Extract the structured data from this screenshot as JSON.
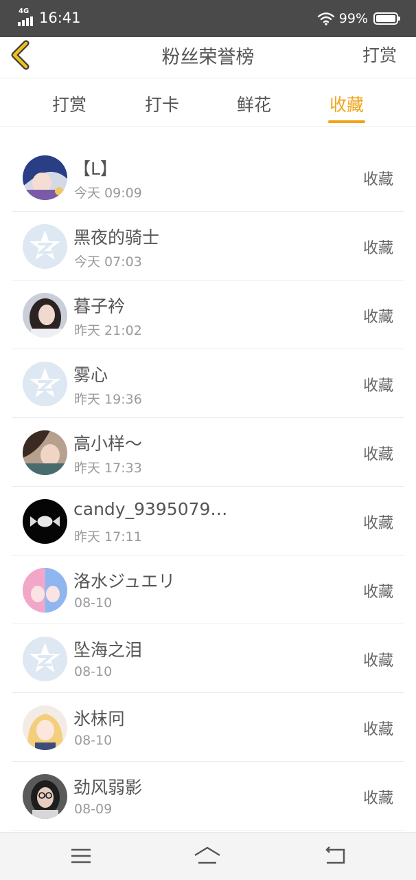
{
  "status_bar": {
    "network": "4G",
    "time": "16:41",
    "battery": "99%",
    "battery_level": 0.99
  },
  "nav": {
    "title": "粉丝荣誉榜",
    "action": "打赏",
    "back_icon": "chevron-left-icon"
  },
  "tabs": [
    {
      "label": "打赏",
      "active": false
    },
    {
      "label": "打卡",
      "active": false
    },
    {
      "label": "鲜花",
      "active": false
    },
    {
      "label": "收藏",
      "active": true
    }
  ],
  "colors": {
    "accent": "#f0a418",
    "status_bar": "#4a4a4a",
    "default_avatar": "#dde8f3"
  },
  "fans": [
    {
      "name": "【L】",
      "time": "今天 09:09",
      "action": "收藏",
      "avatar": "anime-blue-hair"
    },
    {
      "name": "黑夜的骑士",
      "time": "今天 07:03",
      "action": "收藏",
      "avatar": "default"
    },
    {
      "name": "暮子衿",
      "time": "昨天 21:02",
      "action": "收藏",
      "avatar": "photo-girl"
    },
    {
      "name": "雾心",
      "time": "昨天 19:36",
      "action": "收藏",
      "avatar": "default"
    },
    {
      "name": "高小样～",
      "time": "昨天 17:33",
      "action": "收藏",
      "avatar": "photo-couple"
    },
    {
      "name": "candy_9395079…",
      "time": "昨天 17:11",
      "action": "收藏",
      "avatar": "candy-black"
    },
    {
      "name": "洛水ジュエリ",
      "time": "08-10",
      "action": "收藏",
      "avatar": "anime-pink"
    },
    {
      "name": "坠海之泪",
      "time": "08-10",
      "action": "收藏",
      "avatar": "default"
    },
    {
      "name": "氷枺冋",
      "time": "08-10",
      "action": "收藏",
      "avatar": "anime-blonde"
    },
    {
      "name": "劲风弱影",
      "time": "08-09",
      "action": "收藏",
      "avatar": "photo-glasses"
    }
  ],
  "system_nav": {
    "menu_icon": "menu-icon",
    "home_icon": "home-icon",
    "back_icon": "back-icon"
  }
}
